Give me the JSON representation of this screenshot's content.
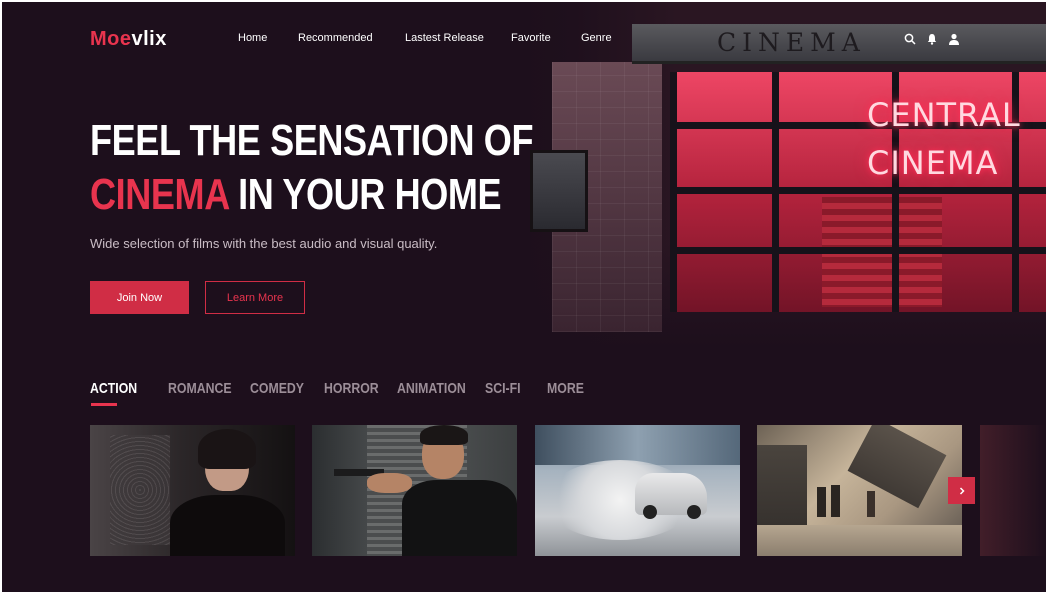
{
  "brand": {
    "logo_accent": "Moe",
    "logo_rest": "vlix",
    "accent_color": "#e8344e",
    "background_color": "#1d0f1c"
  },
  "nav": {
    "items": [
      {
        "label": "Home"
      },
      {
        "label": "Recommended"
      },
      {
        "label": "Lastest Release"
      },
      {
        "label": "Favorite"
      },
      {
        "label": "Genre"
      }
    ],
    "icons": [
      "search-icon",
      "bell-icon",
      "user-icon"
    ]
  },
  "hero": {
    "headline_line1": "FEEL THE SENSATION OF",
    "headline_accent": "CINEMA",
    "headline_line2_rest": " IN YOUR HOME",
    "subtitle": "Wide selection of films with the best audio and visual quality.",
    "primary_button": "Join Now",
    "secondary_button": "Learn More",
    "image": {
      "facade_sign": "CINEMA",
      "neon_line1": "CENTRAL",
      "neon_line2": "CINEMA"
    }
  },
  "genres": {
    "active": "ACTION",
    "tabs": [
      "ACTION",
      "ROMANCE",
      "COMEDY",
      "HORROR",
      "ANIMATION",
      "SCI-FI",
      "MORE"
    ]
  },
  "movies": {
    "cards": [
      {
        "image": "woman-in-dark-room"
      },
      {
        "image": "man-aiming-gun"
      },
      {
        "image": "drifting-car-smoke"
      },
      {
        "image": "street-rescue-dust"
      }
    ],
    "next_icon": "chevron-right-icon"
  }
}
